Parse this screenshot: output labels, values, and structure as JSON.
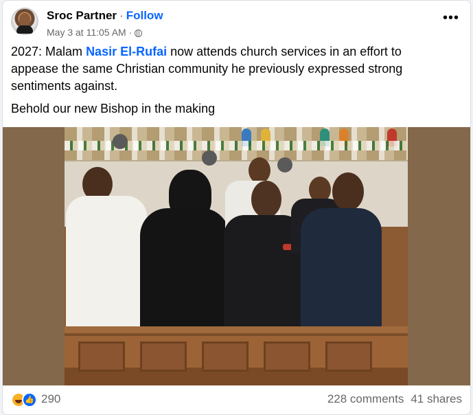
{
  "post": {
    "author": "Sroc Partner",
    "separator": "·",
    "follow_label": "Follow",
    "timestamp": "May 3 at 11:05 AM",
    "audience_icon": "globe-icon",
    "more_icon": "more-options-icon",
    "more_label": "•••",
    "text_before": "2027: Malam ",
    "mention": "Nasir El-Rufai",
    "text_after": " now attends church services in an effort to appease the same Christian community he previously expressed strong sentiments against.",
    "second_paragraph": "Behold our new Bishop in the making"
  },
  "footer": {
    "reaction_icons": [
      "haha-icon",
      "like-icon"
    ],
    "reaction_count": "290",
    "comments": "228 comments",
    "shares": "41 shares"
  },
  "colors": {
    "link": "#0866ff",
    "secondary_text": "#65676b",
    "photo_frame": "#84684b"
  }
}
